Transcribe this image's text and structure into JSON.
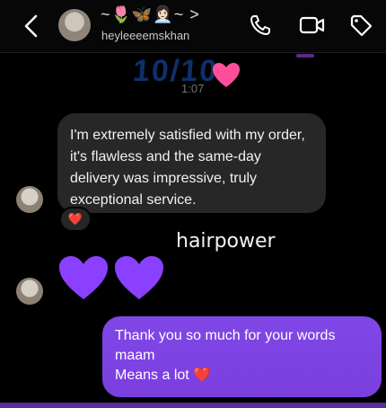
{
  "header": {
    "title": "~🌷🦋👩🏻‍💼~ >",
    "username": "heyleeeemskhan"
  },
  "story_reply": {
    "big_text": "10/10",
    "small_text": "1:07"
  },
  "messages": {
    "incoming_text": "I'm extremely satisfied with my order, it's flawless and the same-day delivery was impressive, truly exceptional service.",
    "reaction": "❤️",
    "handle_text": "hairpower",
    "outgoing_lines": [
      "Thank you so much for your words",
      "maam",
      "Means a lot ❤️"
    ]
  },
  "colors": {
    "outgoing_bubble": "#7b3fe0",
    "incoming_bubble": "#272727",
    "heart_purple": "#8b3fff",
    "reaction_heart": "#e63232"
  }
}
